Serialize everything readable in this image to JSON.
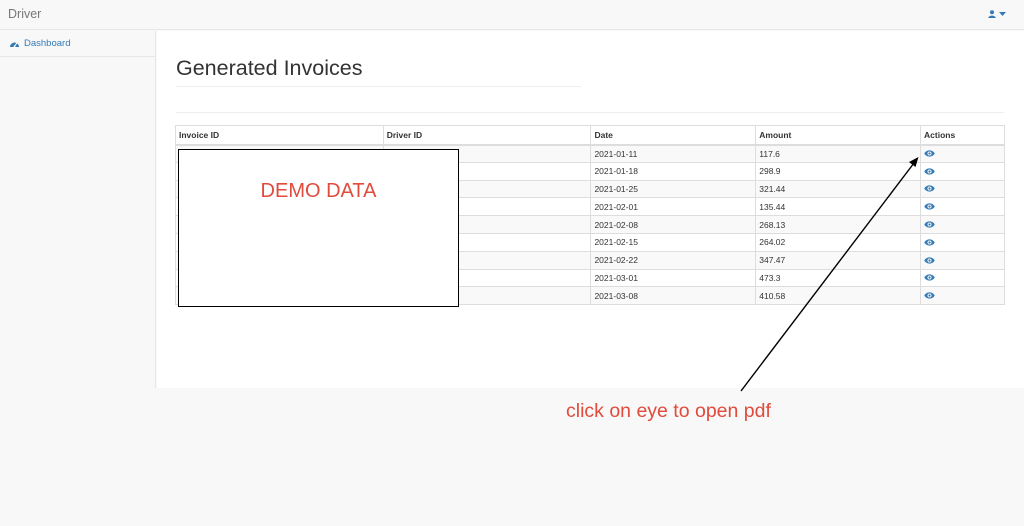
{
  "navbar": {
    "brand": "Driver",
    "user_icon": "user-icon",
    "caret_icon": "caret-down-icon"
  },
  "sidebar": {
    "items": [
      {
        "label": "Dashboard",
        "icon": "dashboard-icon"
      }
    ]
  },
  "main": {
    "title": "Generated Invoices",
    "table": {
      "columns": [
        "Invoice ID",
        "Driver ID",
        "Date",
        "Amount",
        "Actions"
      ],
      "rows": [
        {
          "invoice_id": "",
          "driver_id": "",
          "date": "2021-01-11",
          "amount": "117.6",
          "action_icon": "eye-icon"
        },
        {
          "invoice_id": "",
          "driver_id": "",
          "date": "2021-01-18",
          "amount": "298.9",
          "action_icon": "eye-icon"
        },
        {
          "invoice_id": "",
          "driver_id": "",
          "date": "2021-01-25",
          "amount": "321.44",
          "action_icon": "eye-icon"
        },
        {
          "invoice_id": "",
          "driver_id": "",
          "date": "2021-02-01",
          "amount": "135.44",
          "action_icon": "eye-icon"
        },
        {
          "invoice_id": "",
          "driver_id": "",
          "date": "2021-02-08",
          "amount": "268.13",
          "action_icon": "eye-icon"
        },
        {
          "invoice_id": "",
          "driver_id": "",
          "date": "2021-02-15",
          "amount": "264.02",
          "action_icon": "eye-icon"
        },
        {
          "invoice_id": "",
          "driver_id": "",
          "date": "2021-02-22",
          "amount": "347.47",
          "action_icon": "eye-icon"
        },
        {
          "invoice_id": "",
          "driver_id": "",
          "date": "2021-03-01",
          "amount": "473.3",
          "action_icon": "eye-icon"
        },
        {
          "invoice_id": "",
          "driver_id": "",
          "date": "2021-03-08",
          "amount": "410.58",
          "action_icon": "eye-icon"
        }
      ]
    }
  },
  "overlay": {
    "demo_label": "DEMO DATA",
    "annotation": "click on eye to open pdf"
  },
  "colors": {
    "link": "#337ab7",
    "annotation": "#e04b3c",
    "border": "#dddddd"
  }
}
